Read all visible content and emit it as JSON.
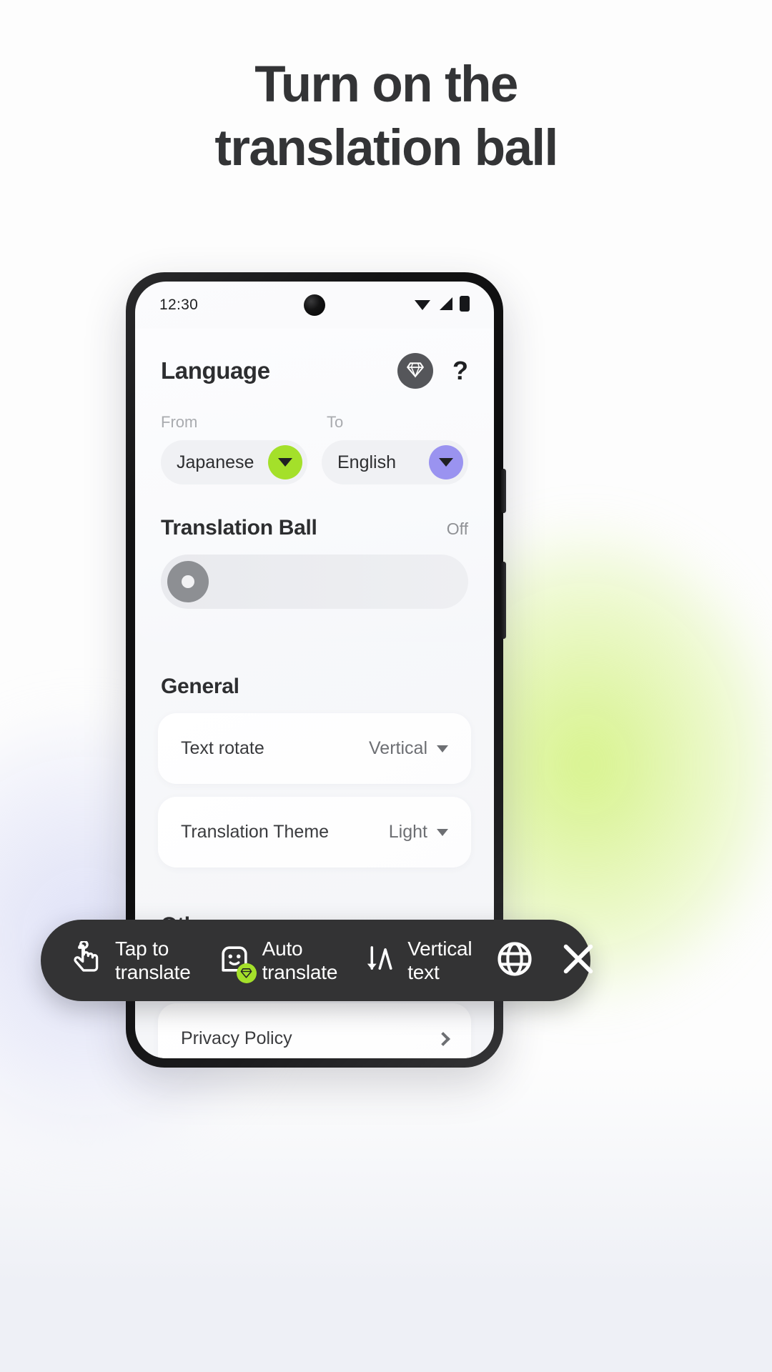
{
  "page": {
    "headline_line1": "Turn on the",
    "headline_line2": "translation ball",
    "accent_green": "#a4e02a",
    "accent_purple": "#9a93f0",
    "toolbar_bg": "#333334",
    "text_dark": "#2d2e30"
  },
  "phone": {
    "status_bar": {
      "clock": "12:30",
      "icons": [
        "wifi-icon",
        "signal-icon",
        "battery-icon"
      ]
    },
    "header": {
      "title": "Language",
      "premium_icon": "diamond-icon",
      "help_label": "?"
    },
    "language": {
      "from_label": "From",
      "to_label": "To",
      "from_value": "Japanese",
      "to_value": "English",
      "from_caret_icon": "chevron-down-icon",
      "to_caret_icon": "chevron-down-icon"
    },
    "translation_ball": {
      "title": "Translation Ball",
      "state": "Off"
    },
    "general": {
      "title": "General",
      "rows": [
        {
          "label": "Text rotate",
          "value": "Vertical",
          "icon": "chevron-down-icon"
        },
        {
          "label": "Translation Theme",
          "value": "Light",
          "icon": "chevron-down-icon"
        }
      ]
    },
    "others": {
      "title": "Others",
      "rows": [
        {
          "label": "Privacy Policy",
          "value": "",
          "icon": "chevron-right-icon"
        }
      ]
    }
  },
  "toolbar": {
    "items": [
      {
        "label_line1": "Tap to",
        "label_line2": "translate",
        "icon": "tap-hand-icon",
        "badge": ""
      },
      {
        "label_line1": "Auto",
        "label_line2": "translate",
        "icon": "robot-face-icon",
        "badge": "diamond-icon"
      },
      {
        "label_line1": "Vertical",
        "label_line2": "text",
        "icon": "vertical-text-icon",
        "badge": ""
      }
    ],
    "globe_icon": "globe-icon",
    "close_icon": "close-icon"
  }
}
